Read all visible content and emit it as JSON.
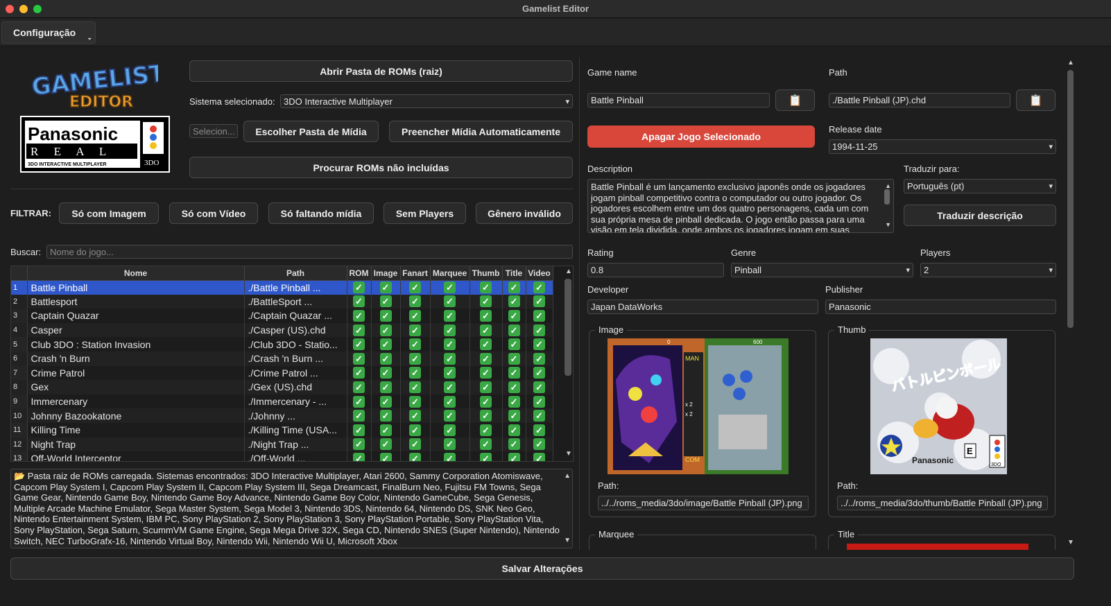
{
  "window": {
    "title": "Gamelist Editor"
  },
  "menu": {
    "config_label": "Configuração"
  },
  "logo": {
    "brand_text": "GAMELIST EDITOR",
    "system_logo_text": "Panasonic REAL 3DO INTERACTIVE MULTIPLAYER"
  },
  "left": {
    "open_roms_button": "Abrir Pasta de ROMs (raiz)",
    "system_label": "Sistema selecionado:",
    "system_value": "3DO Interactive Multiplayer",
    "media_folder_placeholder": "Selecion...",
    "choose_media_button": "Escolher Pasta de Mídia",
    "autofill_media_button": "Preencher Mídia Automaticamente",
    "find_missing_button": "Procurar ROMs não incluídas",
    "filter_label": "FILTRAR:",
    "filters": [
      "Só com Imagem",
      "Só com Vídeo",
      "Só faltando mídia",
      "Sem Players",
      "Gênero inválido"
    ],
    "search_label": "Buscar:",
    "search_placeholder": "Nome do jogo..."
  },
  "table": {
    "columns": [
      "Nome",
      "Path",
      "ROM",
      "Image",
      "Fanart",
      "Marquee",
      "Thumb",
      "Title",
      "Video"
    ],
    "rows": [
      {
        "n": "1",
        "name": "Battle Pinball",
        "path": "./Battle Pinball ..."
      },
      {
        "n": "2",
        "name": "Battlesport",
        "path": "./BattleSport ..."
      },
      {
        "n": "3",
        "name": "Captain Quazar",
        "path": "./Captain Quazar ..."
      },
      {
        "n": "4",
        "name": "Casper",
        "path": "./Casper (US).chd"
      },
      {
        "n": "5",
        "name": "Club 3DO : Station Invasion",
        "path": "./Club 3DO - Statio..."
      },
      {
        "n": "6",
        "name": "Crash 'n Burn",
        "path": "./Crash 'n Burn ..."
      },
      {
        "n": "7",
        "name": "Crime Patrol",
        "path": "./Crime Patrol ..."
      },
      {
        "n": "8",
        "name": "Gex",
        "path": "./Gex (US).chd"
      },
      {
        "n": "9",
        "name": "Immercenary",
        "path": "./Immercenary - ..."
      },
      {
        "n": "10",
        "name": "Johnny Bazookatone",
        "path": "./Johnny ..."
      },
      {
        "n": "11",
        "name": "Killing Time",
        "path": "./Killing Time (USA..."
      },
      {
        "n": "12",
        "name": "Night Trap",
        "path": "./Night Trap ..."
      },
      {
        "n": "13",
        "name": "Off-World Interceptor",
        "path": "./Off-World ..."
      }
    ],
    "check_glyph": "✓"
  },
  "log": {
    "icon": "folder-icon",
    "text": "📂 Pasta raiz de ROMs carregada. Sistemas encontrados: 3DO Interactive Multiplayer, Atari 2600, Sammy Corporation Atomiswave, Capcom Play System I, Capcom Play System II, Capcom Play System III, Sega Dreamcast, FinalBurn Neo, Fujitsu FM Towns, Sega Game Gear, Nintendo Game Boy, Nintendo Game Boy Advance, Nintendo Game Boy Color, Nintendo GameCube, Sega Genesis, Multiple Arcade Machine Emulator, Sega Master System, Sega Model 3, Nintendo 3DS, Nintendo 64, Nintendo DS, SNK Neo Geo, Nintendo Entertainment System, IBM PC, Sony PlayStation 2, Sony PlayStation 3, Sony PlayStation Portable, Sony PlayStation Vita, Sony PlayStation, Sega Saturn, ScummVM Game Engine, Sega Mega Drive 32X, Sega CD, Nintendo SNES (Super Nintendo), Nintendo Switch, NEC TurboGrafx-16, Nintendo Virtual Boy, Nintendo Wii, Nintendo Wii U, Microsoft Xbox"
  },
  "detail": {
    "game_name_label": "Game name",
    "game_name_value": "Battle Pinball",
    "path_label": "Path",
    "path_value": "./Battle Pinball (JP).chd",
    "delete_button": "Apagar Jogo Selecionado",
    "release_label": "Release date",
    "release_value": "1994-11-25",
    "description_label": "Description",
    "description_value": "Battle Pinball é um lançamento exclusivo japonês onde os jogadores jogam pinball competitivo contra o computador ou outro jogador. Os jogadores escolhem entre um dos quatro personagens, cada um com sua própria mesa de pinball dedicada. O jogo então passa para uma visão em tela dividida, onde ambos os jogadores jogam em suas",
    "translate_label": "Traduzir para:",
    "translate_value": "Português (pt)",
    "translate_button": "Traduzir descrição",
    "rating_label": "Rating",
    "rating_value": "0.8",
    "genre_label": "Genre",
    "genre_value": "Pinball",
    "players_label": "Players",
    "players_value": "2",
    "developer_label": "Developer",
    "developer_value": "Japan DataWorks",
    "publisher_label": "Publisher",
    "publisher_value": "Panasonic",
    "image_group": "Image",
    "image_path_label": "Path:",
    "image_path_value": "../../roms_media/3do/image/Battle Pinball (JP).png",
    "image_score_left": "0",
    "image_score_right": "600",
    "image_tag_man": "MAN",
    "image_tag_com": "COM",
    "image_tag_x2a": "x 2",
    "image_tag_x2b": "x 2",
    "thumb_group": "Thumb",
    "thumb_path_label": "Path:",
    "thumb_path_value": "../../roms_media/3do/thumb/Battle Pinball (JP).png",
    "thumb_cover_text": "バトルピンボール",
    "thumb_cover_brand": "Panasonic",
    "thumb_cover_3do": "3DO",
    "thumb_cover_rating": "E",
    "marquee_group": "Marquee",
    "title_group": "Title"
  },
  "footer": {
    "save_button": "Salvar Alterações"
  },
  "colors": {
    "accent_selection": "#2f57c9",
    "danger": "#d9473b",
    "check": "#39a845"
  }
}
